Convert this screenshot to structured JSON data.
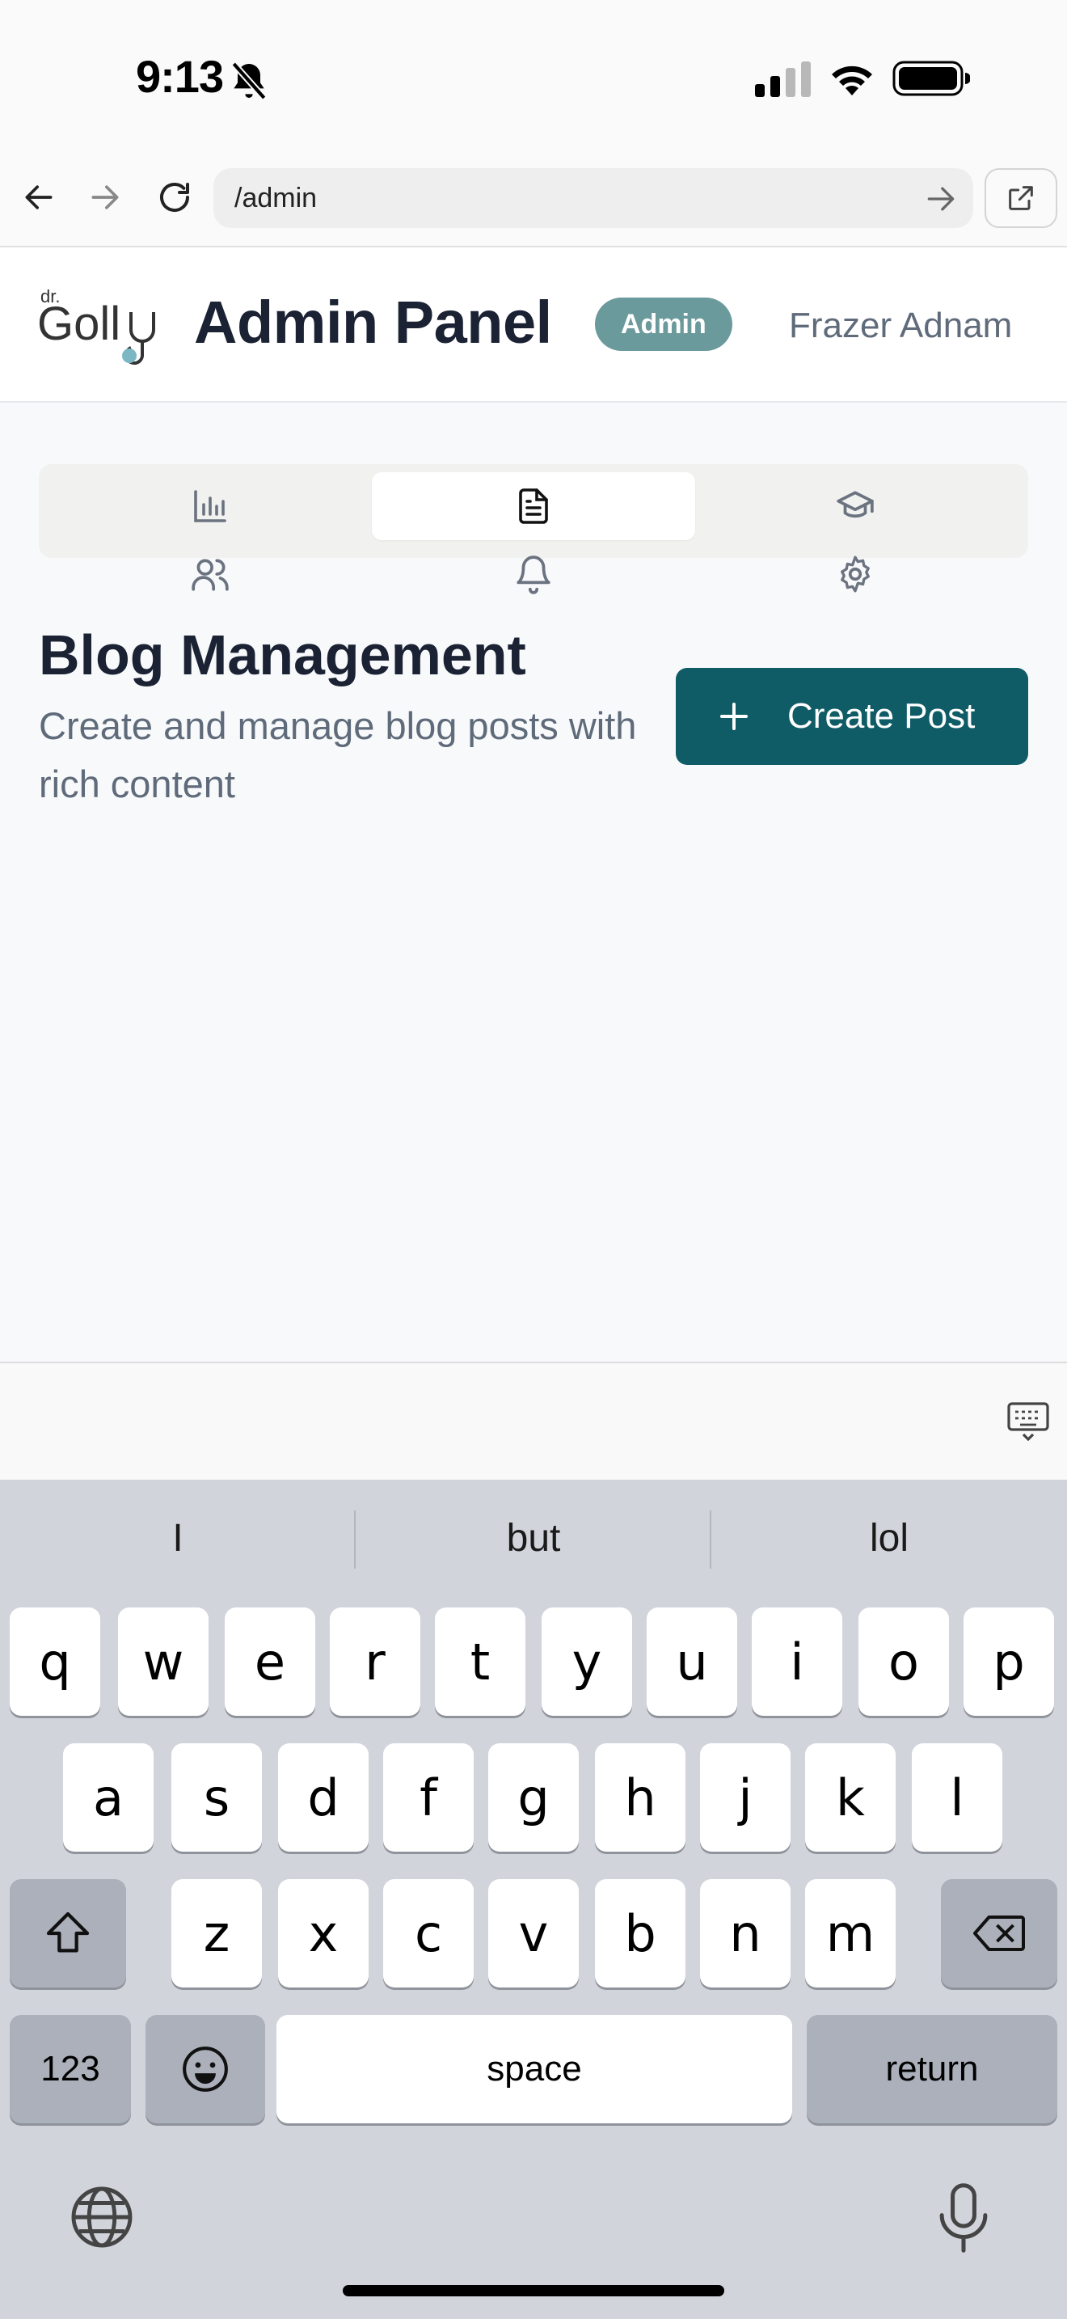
{
  "status_bar": {
    "time": "9:13"
  },
  "browser": {
    "url": "/admin"
  },
  "header": {
    "title": "Admin Panel",
    "badge": "Admin",
    "user_name": "Frazer Adnam"
  },
  "tabs": [
    {
      "icon": "bar-chart-icon",
      "active": false
    },
    {
      "icon": "document-icon",
      "active": true
    },
    {
      "icon": "graduation-cap-icon",
      "active": false
    },
    {
      "icon": "users-icon",
      "active": false
    },
    {
      "icon": "bell-icon",
      "active": false
    },
    {
      "icon": "gear-icon",
      "active": false
    }
  ],
  "section": {
    "title": "Blog Management",
    "description": "Create and manage blog posts with rich content",
    "create_button": "Create Post"
  },
  "keyboard": {
    "suggestions": [
      "I",
      "but",
      "lol"
    ],
    "row1": [
      "q",
      "w",
      "e",
      "r",
      "t",
      "y",
      "u",
      "i",
      "o",
      "p"
    ],
    "row2": [
      "a",
      "s",
      "d",
      "f",
      "g",
      "h",
      "j",
      "k",
      "l"
    ],
    "row3": [
      "z",
      "x",
      "c",
      "v",
      "b",
      "n",
      "m"
    ],
    "numbers_label": "123",
    "space_label": "space",
    "return_label": "return"
  },
  "colors": {
    "accent": "#0f5c66",
    "badge": "#6b9a9c",
    "title": "#1a2233",
    "muted": "#5f6b7a"
  }
}
